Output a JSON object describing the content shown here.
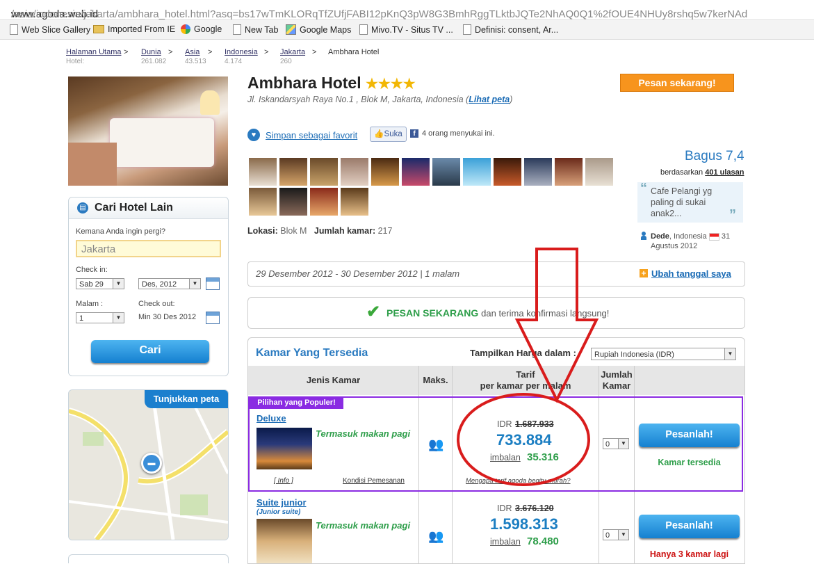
{
  "browser": {
    "url_host": "www.agoda.web.id",
    "url_path": "/asia/indonesia/jakarta/ambhara_hotel.html?asq=bs17wTmKLORqTfZUfjFABI12pKnQ3pW8G3BmhRggTLktbJQTe2NhAQ0Q1%2fOUE4NHUy8rshq5w7kerNAd",
    "favorites": [
      "Web Slice Gallery",
      "Imported From IE",
      "Google",
      "New Tab",
      "Google Maps",
      "Mivo.TV - Situs TV ...",
      "Definisi: consent, Ar..."
    ]
  },
  "breadcrumb": {
    "items": [
      {
        "label": "Halaman Utama",
        "sub": "Hotel:"
      },
      {
        "label": "Dunia",
        "sub": "261.082"
      },
      {
        "label": "Asia",
        "sub": "43.513"
      },
      {
        "label": "Indonesia",
        "sub": "4.174"
      },
      {
        "label": "Jakarta",
        "sub": "260"
      },
      {
        "label": "Ambhara Hotel",
        "sub": ""
      }
    ],
    "separator": ">"
  },
  "hotel": {
    "name": "Ambhara Hotel",
    "stars": "★★★★",
    "address": "Jl. Iskandarsyah Raya No.1 , Blok M, Jakarta, Indonesia (",
    "map_link": "Lihat peta",
    "address_end": ")",
    "book_now": "Pesan sekarang!",
    "favorite": "Simpan sebagai favorit",
    "like_button": "Suka",
    "like_text": "4 orang menyukai ini.",
    "location_label": "Lokasi:",
    "location_value": "Blok M",
    "rooms_label": "Jumlah kamar:",
    "rooms_value": "217"
  },
  "rating": {
    "score": "Bagus 7,4",
    "based_on": "berdasarkan",
    "reviews": "401 ulasan",
    "quote": "Cafe Pelangi yg paling di sukai anak2...",
    "reviewer": "Dede",
    "country": ", Indonesia",
    "date": "31 Agustus 2012"
  },
  "search": {
    "title": "Cari Hotel Lain",
    "where_label": "Kemana Anda ingin pergi?",
    "where_value": "Jakarta",
    "checkin_label": "Check in:",
    "checkin_day": "Sab 29",
    "checkin_month": "Des, 2012",
    "nights_label": "Malam :",
    "nights_value": "1",
    "checkout_label": "Check out:",
    "checkout_value": "Min 30 Des 2012",
    "submit": "Cari"
  },
  "map": {
    "label": "Tunjukkan peta"
  },
  "stay": {
    "dates": "29 Desember 2012 - 30 Desember 2012 | 1 malam",
    "change": "Ubah tanggal saya"
  },
  "confirm": {
    "highlight": "PESAN SEKARANG",
    "rest": "dan terima konfirmasi langsung!"
  },
  "room_table": {
    "title": "Kamar Yang Tersedia",
    "currency_label": "Tampilkan Harga dalam :",
    "currency_value": "Rupiah Indonesia (IDR)",
    "headers": {
      "type": "Jenis Kamar",
      "max": "Maks.",
      "rate1": "Tarif",
      "rate2": "per kamar per malam",
      "qty1": "Jumlah",
      "qty2": "Kamar"
    },
    "popular_badge": "Pilihan yang Populer!",
    "rooms": [
      {
        "name": "Deluxe",
        "subname": "",
        "includes": "Termasuk makan pagi",
        "info": "[ Info ]",
        "conditions": "Kondisi Pemesanan",
        "currency": "IDR",
        "old_price": "1.687.933",
        "price": "733.884",
        "reward_label": "imbalan",
        "reward": "35.316",
        "why_cheap": "Mengapa tarif agoda begitu murah?",
        "qty": "0",
        "book": "Pesanlah!",
        "availability": "Kamar tersedia",
        "availability_color": "#2e9e4a"
      },
      {
        "name": "Suite junior",
        "subname": "(Junior suite)",
        "includes": "Termasuk makan pagi",
        "info": "",
        "conditions": "",
        "currency": "IDR",
        "old_price": "3.676.120",
        "price": "1.598.313",
        "reward_label": "imbalan",
        "reward": "78.480",
        "why_cheap": "",
        "qty": "0",
        "book": "Pesanlah!",
        "availability": "Hanya 3 kamar lagi",
        "availability_color": "#cc1111"
      }
    ]
  },
  "colors": {
    "accent": "#1a6bb5",
    "orange": "#f7941d",
    "annotation_red": "#d91c1c",
    "popular_purple": "#8a2be2"
  }
}
